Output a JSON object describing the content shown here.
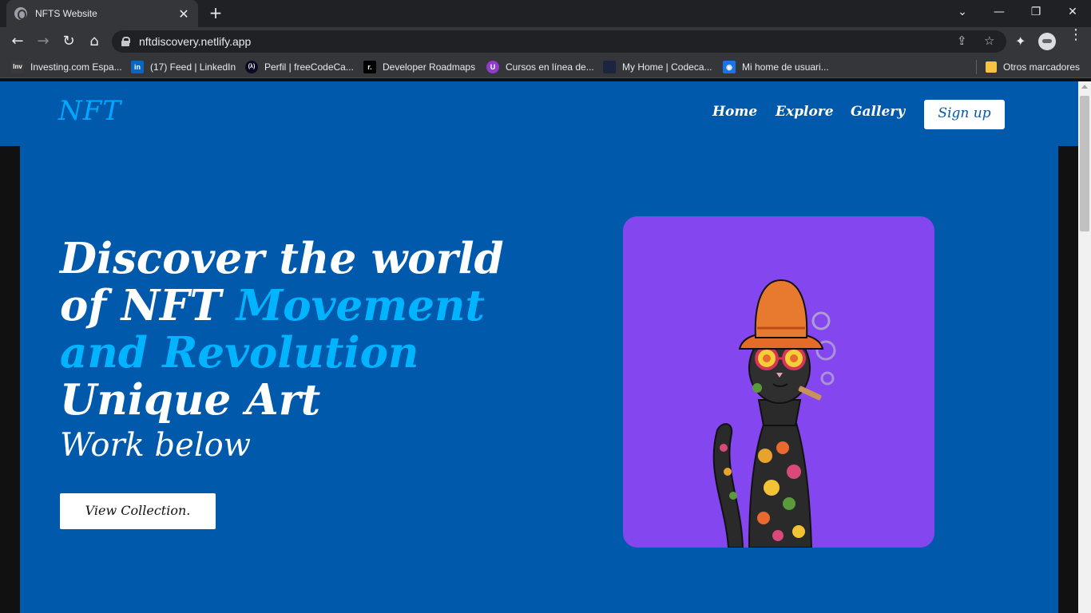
{
  "browser": {
    "tab_title": "NFTS Website",
    "tab_close": "✕",
    "new_tab": "+",
    "url": "nftdiscovery.netlify.app",
    "window_controls": {
      "dropdown": "⌄",
      "minimize": "—",
      "restore": "❐",
      "close": "✕"
    },
    "nav": {
      "back": "←",
      "forward": "→",
      "reload": "↻",
      "home": "⌂"
    },
    "omnibox_icons": {
      "share": "⇪",
      "star": "☆"
    },
    "extensions_icon": "✦",
    "menu": "⋮",
    "bookmarks": [
      {
        "label": "Investing.com Espa...",
        "icon": "Inv",
        "color": "#3a3a3a"
      },
      {
        "label": "(17) Feed | LinkedIn",
        "icon": "in",
        "color": "#0a66c2"
      },
      {
        "label": "Perfil | freeCodeCa...",
        "icon": "(λ)",
        "color": "#0a0a23"
      },
      {
        "label": "Developer Roadmaps",
        "icon": "r.",
        "color": "#000000"
      },
      {
        "label": "Cursos en línea de...",
        "icon": "U",
        "color": "#8e3ccb"
      },
      {
        "label": "My Home | Codeca...",
        "icon": "",
        "color": "#1b2540"
      },
      {
        "label": "Mi home de usuari...",
        "icon": "◉",
        "color": "#1a73e8"
      }
    ],
    "other_bookmarks": "Otros marcadores"
  },
  "site": {
    "logo": "NFT",
    "nav": [
      {
        "label": "Home"
      },
      {
        "label": "Explore"
      },
      {
        "label": "Gallery"
      }
    ],
    "signup": "Sign up"
  },
  "hero": {
    "line1": "Discover the world",
    "line2_white": "of NFT ",
    "line2_accent": "Movement",
    "line3_accent": "and Revolution",
    "line4": "Unique Art",
    "subline": "Work below",
    "cta": "View Collection."
  },
  "colors": {
    "brand_blue": "#0059aa",
    "accent_cyan": "#00b4ff",
    "card_purple": "#8446ef"
  }
}
